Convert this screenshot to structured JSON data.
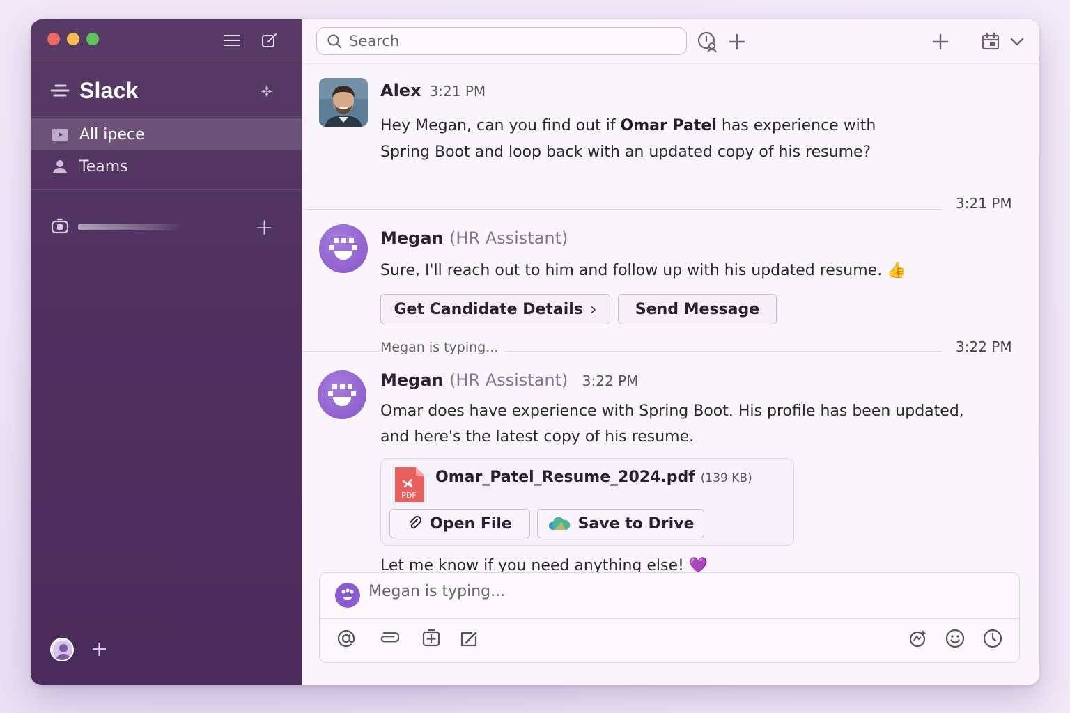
{
  "app": {
    "name": "Slack",
    "colors": {
      "sidebar": "#50325f",
      "accent": "#8a5ad0",
      "window_bg": "#faf5fb"
    }
  },
  "sidebar": {
    "workspace_name": "Slack",
    "nav_items": [
      {
        "label": "All ipece",
        "icon": "inbox-icon",
        "active": true
      },
      {
        "label": "Teams",
        "icon": "person-icon",
        "active": false
      }
    ],
    "channel_add_label": "+",
    "bottom_add_label": "+"
  },
  "topbar": {
    "search_placeholder": "Search"
  },
  "messages": [
    {
      "author": "Alex",
      "time": "3:21 PM",
      "text_pre": "Hey Megan, can you find out if ",
      "text_bold": "Omar Patel",
      "text_post": " has experience with",
      "text_line2": "Spring Boot and loop back with an updated copy of his resume?"
    },
    {
      "author": "Megan",
      "role": "(HR Assistant)",
      "text": "Sure, I'll reach out to him and follow up with his updated resume.",
      "emoji": "👍",
      "actions": [
        "Get Candidate Details",
        "Send Message"
      ]
    },
    {
      "author": "Megan",
      "role": "(HR Assistant)",
      "time": "3:22 PM",
      "text_line1": "Omar does have experience with Spring Boot. His profile has been updated,",
      "text_line2": "and here's the latest copy of his resume.",
      "attachment": {
        "filename": "Omar_Patel_Resume_2024.pdf",
        "size": "(139 KB)",
        "type_label": "PDF",
        "actions": [
          "Open File",
          "Save to Drive"
        ]
      },
      "followup": "Let me know if you need anything else!",
      "followup_emoji": "💜"
    }
  ],
  "separators": {
    "first_time": "3:21 PM",
    "typing_label": "Megan is typing...",
    "second_time": "3:22 PM"
  },
  "composer": {
    "placeholder": "Megan is typing..."
  }
}
